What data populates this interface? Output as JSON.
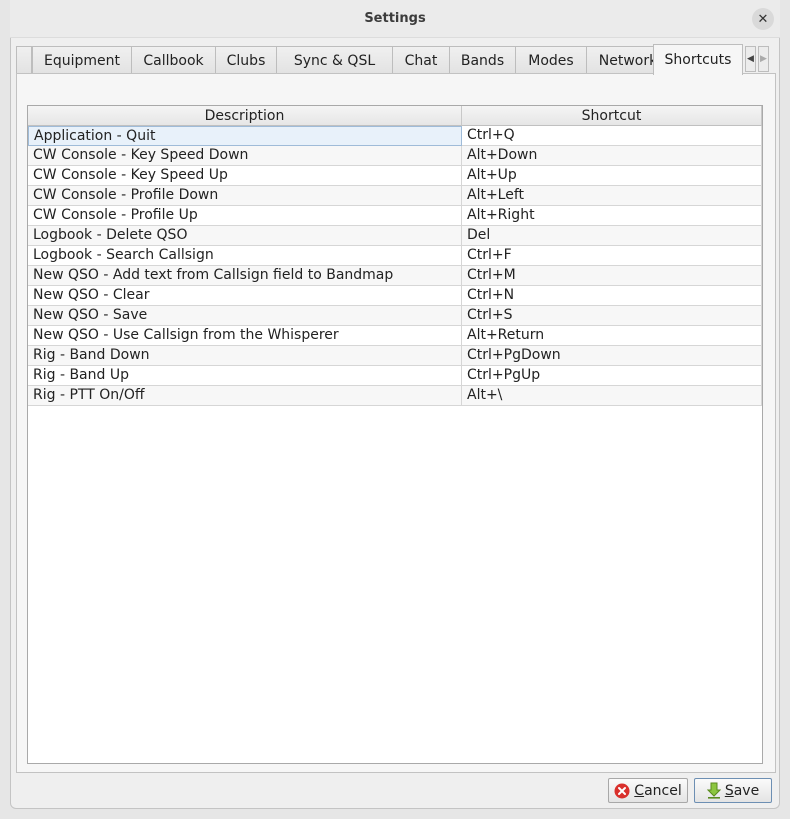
{
  "window": {
    "title": "Settings"
  },
  "tabs": [
    {
      "label": "Equipment"
    },
    {
      "label": "Callbook"
    },
    {
      "label": "Clubs"
    },
    {
      "label": "Sync & QSL"
    },
    {
      "label": "Chat"
    },
    {
      "label": "Bands"
    },
    {
      "label": "Modes"
    },
    {
      "label": "Network"
    },
    {
      "label": "Shortcuts",
      "active": true
    }
  ],
  "table": {
    "columns": [
      "Description",
      "Shortcut"
    ],
    "rows": [
      {
        "description": "Application - Quit",
        "shortcut": "Ctrl+Q",
        "selected": true
      },
      {
        "description": "CW Console - Key Speed Down",
        "shortcut": "Alt+Down"
      },
      {
        "description": "CW Console - Key Speed Up",
        "shortcut": "Alt+Up"
      },
      {
        "description": "CW Console - Profile Down",
        "shortcut": "Alt+Left"
      },
      {
        "description": "CW Console - Profile Up",
        "shortcut": "Alt+Right"
      },
      {
        "description": "Logbook - Delete QSO",
        "shortcut": "Del"
      },
      {
        "description": "Logbook - Search Callsign",
        "shortcut": "Ctrl+F"
      },
      {
        "description": "New QSO - Add text from Callsign field to Bandmap",
        "shortcut": "Ctrl+M"
      },
      {
        "description": "New QSO - Clear",
        "shortcut": "Ctrl+N"
      },
      {
        "description": "New QSO - Save",
        "shortcut": "Ctrl+S"
      },
      {
        "description": "New QSO - Use Callsign from the Whisperer",
        "shortcut": "Alt+Return"
      },
      {
        "description": "Rig - Band Down",
        "shortcut": "Ctrl+PgDown"
      },
      {
        "description": "Rig - Band Up",
        "shortcut": "Ctrl+PgUp"
      },
      {
        "description": "Rig - PTT On/Off",
        "shortcut": "Alt+\\"
      }
    ]
  },
  "buttons": {
    "cancel": {
      "first": "C",
      "rest": "ancel"
    },
    "save": {
      "first": "S",
      "rest": "ave"
    }
  },
  "icons": {
    "close": "close-icon",
    "cancel": "cancel-icon",
    "save": "save-arrow-icon",
    "scroll_left": "chevron-left-icon",
    "scroll_right": "chevron-right-icon"
  },
  "colors": {
    "cancel_icon": "#d9302c",
    "save_icon": "#7cb82f",
    "selection": "#e8f1fa"
  }
}
